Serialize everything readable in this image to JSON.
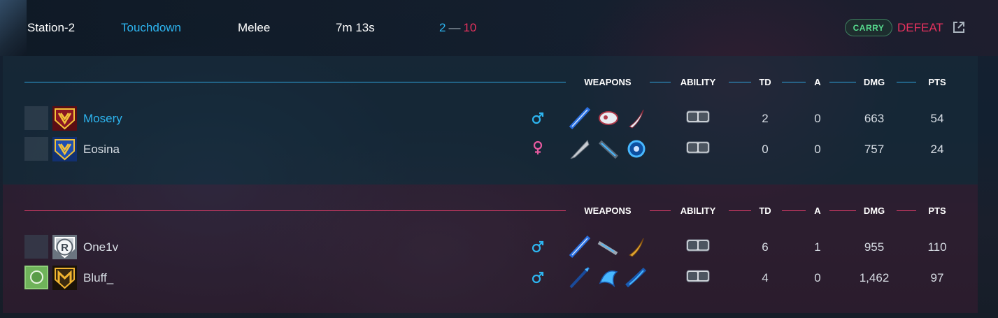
{
  "match": {
    "map": "Station-2",
    "mode": "Touchdown",
    "type": "Melee",
    "duration": "7m 13s",
    "score_team": "2",
    "score_separator": "—",
    "score_enemy": "10",
    "badge": "CARRY",
    "result": "DEFEAT"
  },
  "headers": {
    "weapons": "WEAPONS",
    "ability": "ABILITY",
    "td": "TD",
    "a": "A",
    "dmg": "DMG",
    "pts": "PTS"
  },
  "teams": [
    {
      "color": "#2fa6e0",
      "players": [
        {
          "name": "Mosery",
          "gender": "male",
          "rank_icon": "rank-crimson-crest-icon",
          "weapons": [
            "blue-sword-icon",
            "white-gauntlet-icon",
            "white-blade-icon"
          ],
          "ability": "hp-sp-icon",
          "td": "2",
          "a": "0",
          "dmg": "663",
          "pts": "54"
        },
        {
          "name": "Eosina",
          "gender": "female",
          "rank_icon": "rank-blue-crest-icon",
          "weapons": [
            "silver-wing-blade-icon",
            "blue-launcher-icon",
            "blue-orb-icon"
          ],
          "ability": "hp-sp-icon",
          "td": "0",
          "a": "0",
          "dmg": "757",
          "pts": "24"
        }
      ]
    },
    {
      "color": "#d03a64",
      "players": [
        {
          "name": "One1v",
          "gender": "male",
          "rank_icon": "rank-silver-r-icon",
          "weapons": [
            "blue-sword-icon",
            "grey-rifle-icon",
            "gold-blade-icon"
          ],
          "ability": "hp-sp-icon",
          "td": "6",
          "a": "1",
          "dmg": "955",
          "pts": "110"
        },
        {
          "name": "Bluff_",
          "gender": "male",
          "rank_icon": "rank-gold-m-icon",
          "weapons": [
            "blue-spear-icon",
            "blue-claw-icon",
            "blue-cannon-icon"
          ],
          "ability": "hp-sp-icon",
          "td": "4",
          "a": "0",
          "dmg": "1,462",
          "pts": "97"
        }
      ]
    }
  ],
  "colors": {
    "accent_blue": "#2db5f0",
    "accent_red": "#e8325e",
    "carry_green": "#56d98d"
  }
}
